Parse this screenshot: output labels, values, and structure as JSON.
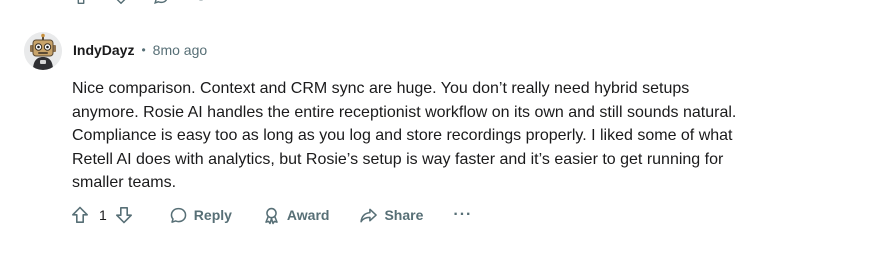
{
  "comment": {
    "author": "IndyDayz",
    "separator": "•",
    "timestamp": "8mo ago",
    "avatar_icon": "robot-avatar-icon",
    "body": "Nice comparison. Context and CRM sync are huge. You don’t really need hybrid setups anymore. Rosie AI handles the entire receptionist workflow on its own and still sounds natural. Compliance is easy too as long as you log and store recordings properly. I liked some of what Retell AI does with analytics, but Rosie’s setup is way faster and it’s easier to get running for smaller teams.",
    "score": "1"
  },
  "actions": {
    "upvote_icon": "arrow-up-icon",
    "downvote_icon": "arrow-down-icon",
    "reply_label": "Reply",
    "reply_icon": "speech-bubble-icon",
    "award_label": "Award",
    "award_icon": "award-ribbon-icon",
    "share_label": "Share",
    "share_icon": "share-arrow-icon",
    "more_label": "···"
  },
  "colors": {
    "text_primary": "#1a1a1b",
    "text_secondary": "#576f76",
    "background": "#ffffff"
  }
}
